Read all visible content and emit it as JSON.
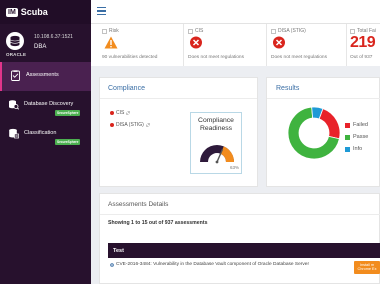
{
  "app": {
    "logo_text": "IM",
    "name": "Scuba"
  },
  "database": {
    "type_label": "ORACLE",
    "ip": "10.108.6.37:1521",
    "user": "DBA"
  },
  "sidebar": {
    "items": [
      {
        "label": "Assessments",
        "active": true,
        "icon": "assessments-icon",
        "badge": ""
      },
      {
        "label": "Database Discovery",
        "active": false,
        "icon": "database-discovery-icon",
        "badge": "SecureSphere"
      },
      {
        "label": "Classification",
        "active": false,
        "icon": "classification-icon",
        "badge": "SecureSphere"
      }
    ]
  },
  "summary": {
    "risk": {
      "title": "Risk",
      "text": "90 vulnerabilities detected"
    },
    "cis": {
      "title": "CIS",
      "text": "Does not meet regulations"
    },
    "disa": {
      "title": "DISA (STIG)",
      "text": "Does not meet regulations"
    },
    "total": {
      "title": "Total Fai",
      "number": "219",
      "text": "Out of 937"
    }
  },
  "compliance": {
    "title": "Compliance",
    "items": [
      {
        "label": "CIS"
      },
      {
        "label": "DISA (STIG)"
      }
    ],
    "gauge_title_line1": "Compliance",
    "gauge_title_line2": "Readiness",
    "gauge_percent": "63%",
    "gauge_value": 63
  },
  "results": {
    "title": "Results",
    "legend": [
      {
        "label": "Failed",
        "color": "#e8222a"
      },
      {
        "label": "Passe",
        "color": "#3fb33f"
      },
      {
        "label": "Info",
        "color": "#1e9ad6"
      }
    ]
  },
  "chart_data": {
    "type": "pie",
    "variant": "donut",
    "categories": [
      "Failed",
      "Passed",
      "Info"
    ],
    "values": [
      23,
      70,
      7
    ],
    "colors": [
      "#e8222a",
      "#3fb33f",
      "#1e9ad6"
    ]
  },
  "assessments": {
    "title": "Assessments Details",
    "showing": "Showing 1 to 15 out of 937 assessments",
    "column": "Test",
    "rows": [
      {
        "text": "CVE-2016-3484: Vulnerability in the Database Vault component of Oracle Database Server"
      }
    ]
  },
  "install_button": {
    "line1": "Install m",
    "line2": "Chrome Ex"
  },
  "colors": {
    "sidebar": "#27112d",
    "accent": "#e0358b",
    "link": "#3a6ea5",
    "danger": "#d9251d",
    "warning": "#f28c1e"
  }
}
